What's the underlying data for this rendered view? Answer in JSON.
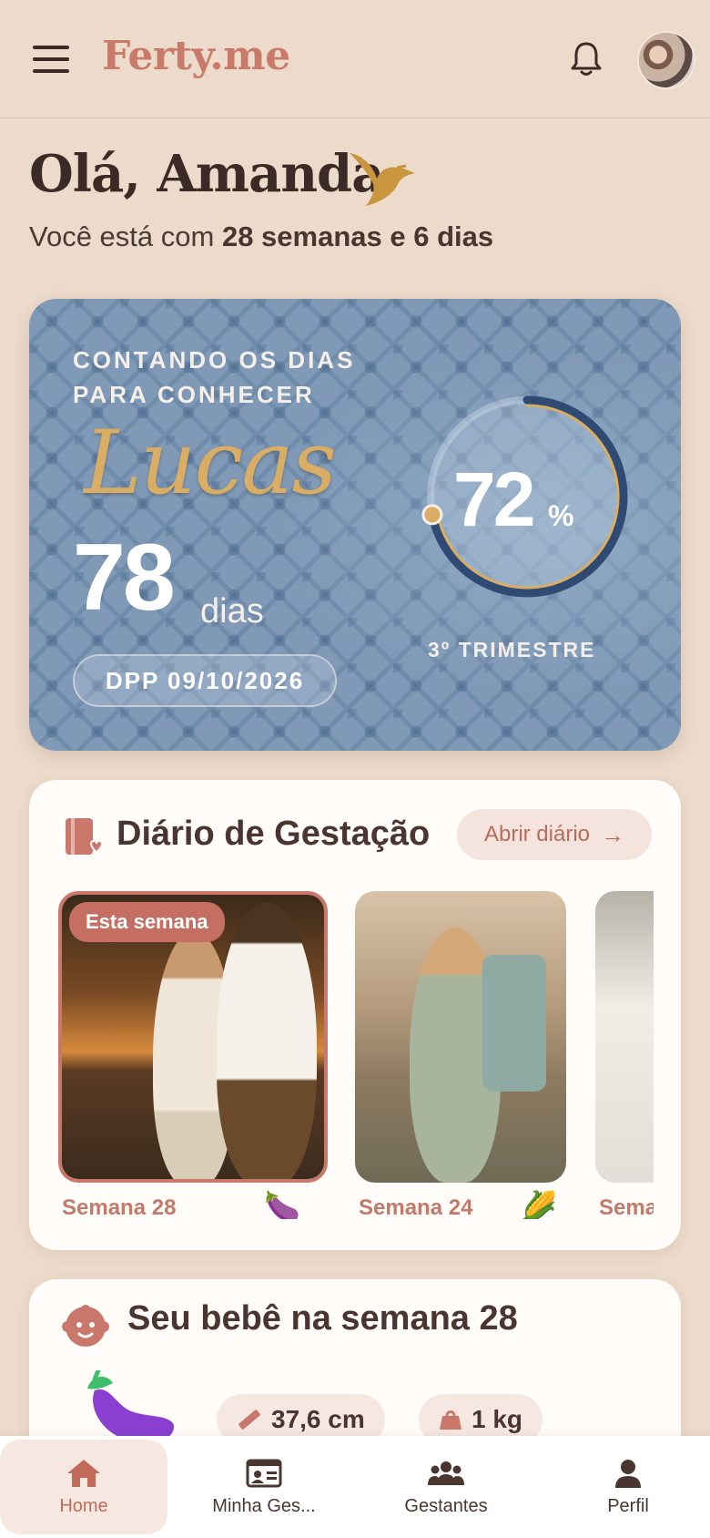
{
  "header": {
    "brand": "Ferty.me",
    "menu_icon": "hamburger-menu-icon",
    "notification_icon": "bell-icon"
  },
  "greeting": {
    "title": "Olá, Amanda",
    "subtitle_prefix": "Você está com ",
    "subtitle_bold": "28 semanas e 6 dias"
  },
  "countdown": {
    "heading_line1": "CONTANDO OS DIAS",
    "heading_line2": "PARA CONHECER",
    "baby_name": "Lucas",
    "days": "78",
    "days_label": "dias",
    "dpp": "DPP 09/10/2026",
    "progress_value": "72",
    "progress_unit": "%",
    "progress_fraction": 0.72,
    "trimester": "3º TRIMESTRE",
    "accent_color": "#d9ad63",
    "ring_color": "#2f4a73"
  },
  "diary": {
    "title": "Diário de Gestação",
    "button_label": "Abrir diário",
    "entries": [
      {
        "badge": "Esta semana",
        "label": "Semana 28",
        "emoji": "🍆"
      },
      {
        "label": "Semana 24",
        "emoji": "🌽"
      },
      {
        "label": "Sema"
      }
    ]
  },
  "baby": {
    "title": "Seu bebê na semana 28",
    "length": "37,6 cm",
    "weight": "1 kg"
  },
  "nav": {
    "items": [
      {
        "label": "Home",
        "icon": "home-icon"
      },
      {
        "label": "Minha Ges...",
        "icon": "id-card-icon"
      },
      {
        "label": "Gestantes",
        "icon": "group-icon"
      },
      {
        "label": "Perfil",
        "icon": "person-icon"
      }
    ]
  }
}
